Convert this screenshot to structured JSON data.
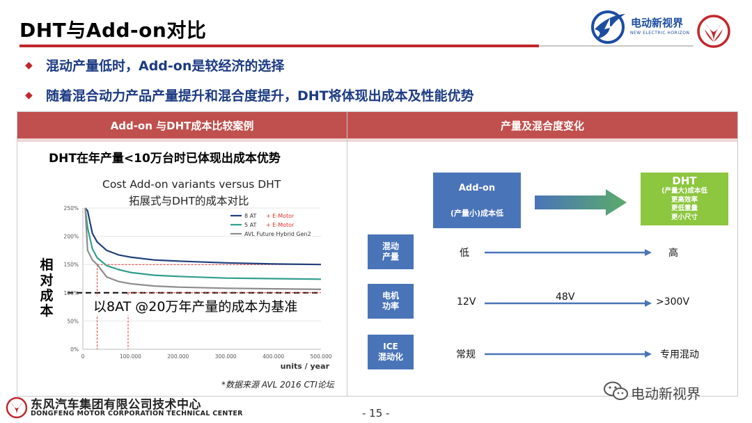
{
  "slide": {
    "title": "DHT与Add-on对比",
    "bullets": [
      "混动产量低时，Add-on是较经济的选择",
      "随着混合动力产品产量提升和混合度提升，DHT将体现出成本及性能优势"
    ],
    "bullet_mark": "◆",
    "page_number": "- 15 -"
  },
  "brand": {
    "logo_cn": "电动新视界",
    "logo_en": "NEW ELECTRIC HORIZON",
    "footer_cn": "东风汽车集团有限公司技术中心",
    "footer_en": "DONGFENG MOTOR CORPORATION TECHNICAL CENTER",
    "watermark": "电动新视界"
  },
  "left_panel": {
    "header": "Add-on 与DHT成本比较案例",
    "heading": "DHT在年产量<10万台时已体现出成本优势",
    "chart_title_line1": "Cost Add-on variants versus DHT",
    "chart_title_line2": "拓展式与DHT的成本对比",
    "ylabel": "相对成本",
    "baseline_note": "以8AT @20万年产量的成本为基准",
    "source_note": "*数据来源 AVL 2016 CTI论坛"
  },
  "chart_data": {
    "type": "line",
    "xlabel": "units / year",
    "ylabel": "相对成本",
    "xlim": [
      0,
      500000
    ],
    "ylim": [
      0,
      250
    ],
    "x_ticks": [
      "0",
      "100.000",
      "200.000",
      "300.000",
      "400.000",
      "500.000"
    ],
    "y_ticks": [
      "0%",
      "50%",
      "100%",
      "150%",
      "200%",
      "250%"
    ],
    "x": [
      5000,
      10000,
      20000,
      30000,
      50000,
      75000,
      100000,
      150000,
      200000,
      300000,
      400000,
      500000
    ],
    "series": [
      {
        "name": "8 AT",
        "suffix": "+ E-Motor",
        "color": "#1f3f7a",
        "values": [
          250,
          245,
          205,
          190,
          175,
          167,
          163,
          158,
          156,
          153,
          151,
          150
        ]
      },
      {
        "name": "5 AT",
        "suffix": "+ E-Motor",
        "color": "#2f9e8e",
        "values": [
          250,
          215,
          178,
          162,
          148,
          141,
          136,
          131,
          129,
          126,
          125,
          124
        ]
      },
      {
        "name": "AVL Future Hybrid Gen2",
        "suffix": "",
        "color": "#8c8c8c",
        "values": [
          250,
          175,
          158,
          150,
          128,
          120,
          116,
          112,
          110,
          108,
          107,
          106
        ]
      }
    ],
    "reference_line": {
      "y": 100,
      "label": "以8AT @20万年产量的成本为基准"
    },
    "markers": [
      {
        "x": 30000,
        "y": 150
      },
      {
        "x": 95000,
        "y": 100
      }
    ],
    "legend_position": "top-right",
    "grid": true
  },
  "right_panel": {
    "header": "产量及混合度变化",
    "addon_box": {
      "title": "Add-on",
      "sub": "(产量小)成本低"
    },
    "dht_box": {
      "title": "DHT",
      "lines": [
        "(产量大)成本低",
        "更高效率",
        "更低重量",
        "更小尺寸"
      ]
    },
    "rows": [
      {
        "label_line1": "混动",
        "label_line2": "产量",
        "from": "低",
        "mid": "",
        "to": "高"
      },
      {
        "label_line1": "电机",
        "label_line2": "功率",
        "from": "12V",
        "mid": "48V",
        "to": ">300V"
      },
      {
        "label_line1": "ICE",
        "label_line2": "混动化",
        "from": "常规",
        "mid": "",
        "to": "专用混动"
      }
    ]
  },
  "colors": {
    "accent_red": "#c0504d",
    "title_rule": "#c0282d",
    "bullet_text": "#1b3a82",
    "box_blue": "#4a74b8",
    "box_green": "#8dc63f"
  }
}
